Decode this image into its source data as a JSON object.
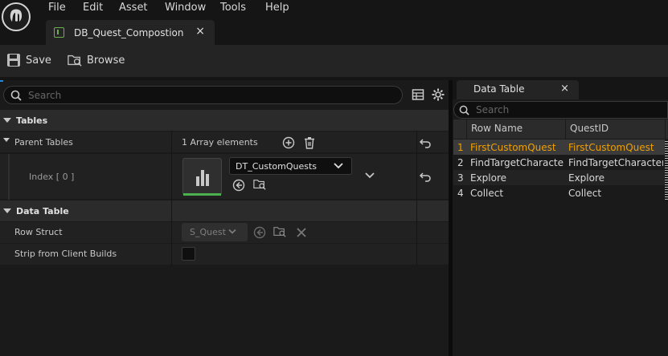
{
  "menu": {
    "items": [
      "File",
      "Edit",
      "Asset",
      "Window",
      "Tools",
      "Help"
    ]
  },
  "document_tab": {
    "label": "DB_Quest_Compostion",
    "close": "×"
  },
  "toolbar": {
    "save_label": "Save",
    "browse_label": "Browse"
  },
  "details": {
    "search_placeholder": "Search",
    "categories": {
      "tables": "Tables",
      "data_table": "Data Table"
    },
    "parent_tables": {
      "label": "Parent Tables",
      "value": "1 Array elements"
    },
    "index_row": {
      "label": "Index [ 0 ]",
      "asset": "DT_CustomQuests"
    },
    "row_struct": {
      "label": "Row Struct",
      "value": "S_Quest"
    },
    "strip_client": {
      "label": "Strip from Client Builds",
      "checked": false
    }
  },
  "data_table": {
    "tab_label": "Data Table",
    "close": "×",
    "search_placeholder": "Search",
    "columns": [
      "Row Name",
      "QuestID"
    ],
    "rows": [
      {
        "num": "1",
        "name": "FirstCustomQuest",
        "quest_id": "FirstCustomQuest"
      },
      {
        "num": "2",
        "name": "FindTargetCharacte",
        "quest_id": "FindTargetCharacter"
      },
      {
        "num": "3",
        "name": "Explore",
        "quest_id": "Explore"
      },
      {
        "num": "4",
        "name": "Collect",
        "quest_id": "Collect"
      }
    ],
    "selected_row_color": "#f0a000"
  }
}
